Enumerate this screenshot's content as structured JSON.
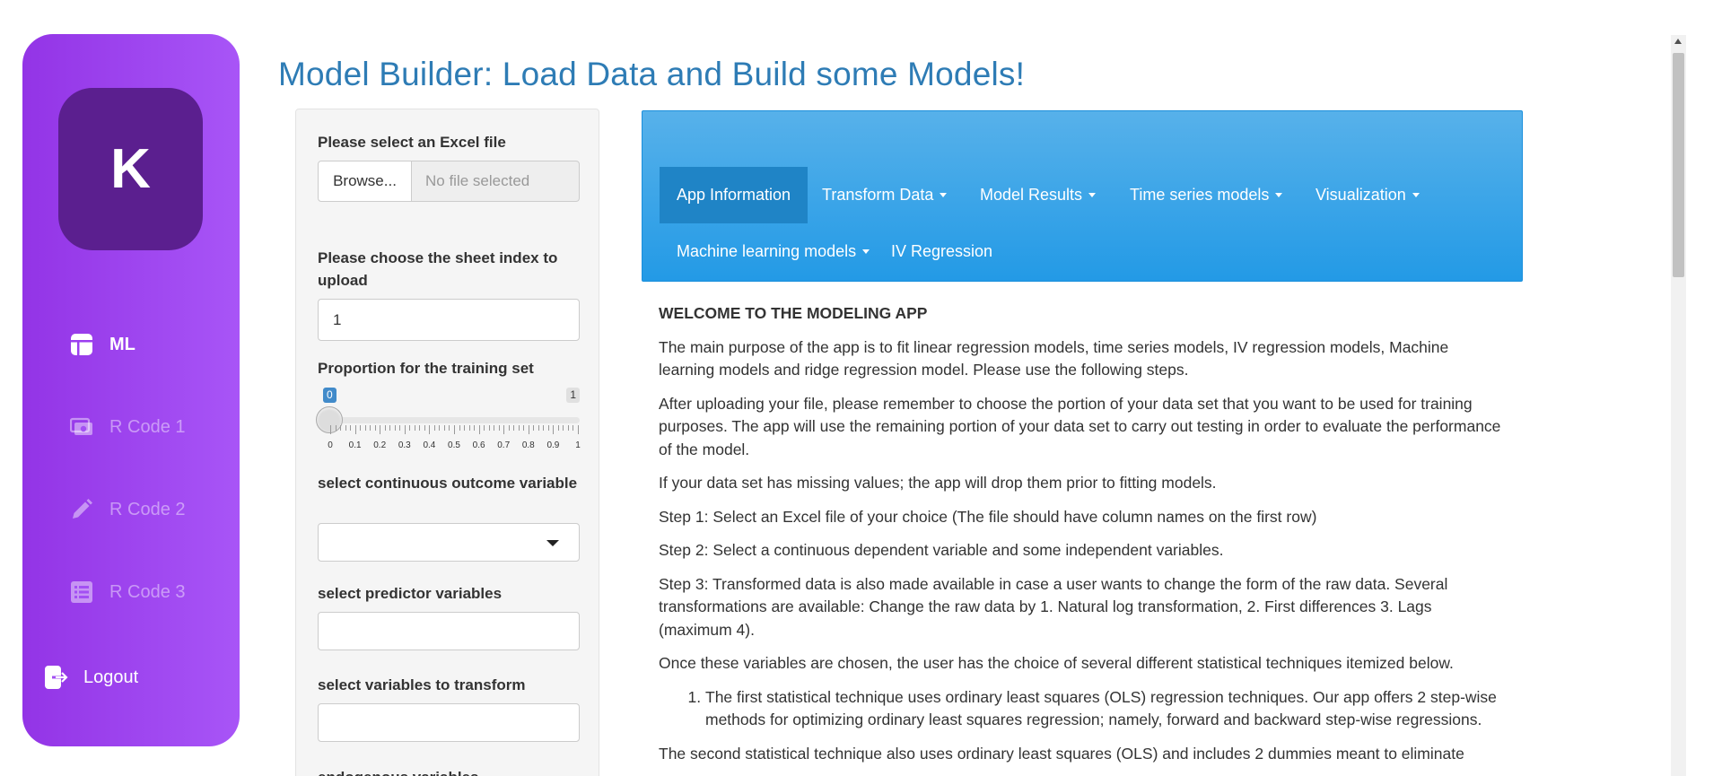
{
  "sidebar": {
    "avatar_letter": "K",
    "items": [
      {
        "label": "ML",
        "icon": "table-icon",
        "active": true
      },
      {
        "label": "R Code 1",
        "icon": "money-icon",
        "active": false
      },
      {
        "label": "R Code 2",
        "icon": "pencil-icon",
        "active": false
      },
      {
        "label": "R Code 3",
        "icon": "list-alt-icon",
        "active": false
      }
    ],
    "logout_label": "Logout",
    "colors": {
      "gradient_start": "#9334e6",
      "gradient_end": "#a855f7",
      "avatar_bg": "#5b1f8f"
    }
  },
  "page": {
    "title": "Model Builder: Load Data and Build some Models!",
    "title_color": "#2e7cb5"
  },
  "panel": {
    "file_label": "Please select an Excel file",
    "browse_label": "Browse...",
    "file_placeholder": "No file selected",
    "sheet_label": "Please choose the sheet index to upload",
    "sheet_value": "1",
    "training_label": "Proportion for the training set",
    "slider": {
      "min_label": "0",
      "max_label": "1",
      "value": 0,
      "tick_labels": [
        "0",
        "0.1",
        "0.2",
        "0.3",
        "0.4",
        "0.5",
        "0.6",
        "0.7",
        "0.8",
        "0.9",
        "1"
      ]
    },
    "outcome_label": "select continuous outcome variable",
    "predictor_label": "select predictor variables",
    "transform_label": "select variables to transform",
    "endogenous_label": "endogenous variables"
  },
  "navbar": {
    "tabs": [
      {
        "label": "App Information",
        "dropdown": false,
        "active": true
      },
      {
        "label": "Transform Data",
        "dropdown": true,
        "active": false
      },
      {
        "label": "Model Results",
        "dropdown": true,
        "active": false
      },
      {
        "label": "Time series models",
        "dropdown": true,
        "active": false
      },
      {
        "label": "Visualization",
        "dropdown": true,
        "active": false
      },
      {
        "label": "Machine learning models",
        "dropdown": true,
        "active": false
      },
      {
        "label": "IV Regression",
        "dropdown": false,
        "active": false
      }
    ],
    "color": "#239ae6",
    "active_color": "#1f84c6"
  },
  "content": {
    "heading": "WELCOME TO THE MODELING APP",
    "paragraphs": [
      "The main purpose of the app is to fit linear regression models, time series models, IV regression models, Machine learning models and ridge regression model. Please use the following steps.",
      "After uploading your file, please remember to choose the portion of your data set that you want to be used for training purposes. The app will use the remaining portion of your data set to carry out testing in order to evaluate the performance of the model.",
      "If your data set has missing values; the app will drop them prior to fitting models.",
      "Step 1: Select an Excel file of your choice (The file should have column names on the first row)",
      "Step 2: Select a continuous dependent variable and some independent variables.",
      "Step 3: Transformed data is also made available in case a user wants to change the form of the raw data. Several transformations are available: Change the raw data by 1. Natural log transformation, 2. First differences 3. Lags (maximum 4).",
      "Once these variables are chosen, the user has the choice of several different statistical techniques itemized below."
    ],
    "list_items": [
      "The first statistical technique uses ordinary least squares (OLS) regression techniques. Our app offers 2 step-wise methods for optimizing ordinary least squares regression; namely, forward and backward step-wise regressions."
    ],
    "trailing_paragraph": "The second statistical technique also uses ordinary least squares (OLS) and includes 2 dummies meant to eliminate"
  }
}
